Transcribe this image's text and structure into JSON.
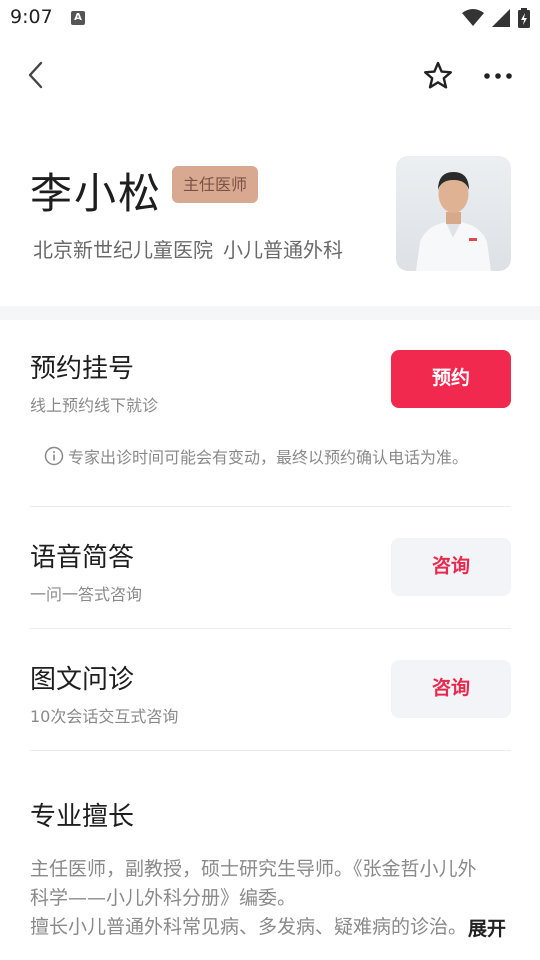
{
  "status_bar": {
    "time": "9:07",
    "app_icon_letter": "A"
  },
  "doctor": {
    "name": "李小松",
    "title_badge": "主任医师",
    "hospital": "北京新世纪儿童医院",
    "department": "小儿普通外科"
  },
  "services": [
    {
      "title": "预约挂号",
      "subtitle": "线上预约线下就诊",
      "button": "预约"
    },
    {
      "title": "语音简答",
      "subtitle": "一问一答式咨询",
      "button": "咨询"
    },
    {
      "title": "图文问诊",
      "subtitle": "10次会话交互式咨询",
      "button": "咨询"
    }
  ],
  "notice": "专家出诊时间可能会有变动，最终以预约确认电话为准。",
  "specialty": {
    "title": "专业擅长",
    "lines": [
      "主任医师，副教授，硕士研究生导师。《张金哲小儿外",
      "科学——小儿外科分册》编委。",
      "擅长小儿普通外科常见病、多发病、疑难病的诊治。"
    ],
    "expand_label": "展开"
  },
  "colors": {
    "accent": "#f2294e",
    "badge_bg": "#d9a890",
    "badge_text": "#7a5346"
  }
}
